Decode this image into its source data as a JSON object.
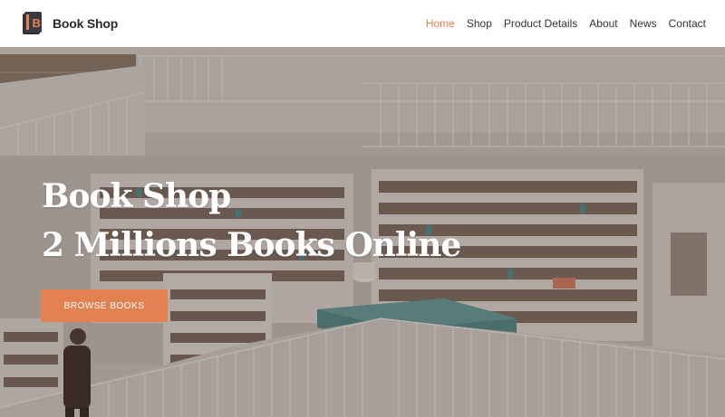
{
  "brand": {
    "name": "Book Shop",
    "logo_letter": "B",
    "accent_color": "#e38152",
    "logo_color": "#2f2f35"
  },
  "nav": {
    "items": [
      {
        "label": "Home",
        "active": true
      },
      {
        "label": "Shop",
        "active": false
      },
      {
        "label": "Product Details",
        "active": false
      },
      {
        "label": "About",
        "active": false
      },
      {
        "label": "News",
        "active": false
      },
      {
        "label": "Contact",
        "active": false
      }
    ]
  },
  "hero": {
    "title_line1": "Book Shop",
    "title_line2": "2 Millions Books Online",
    "cta_label": "BROWSE BOOKS",
    "background_scene": "library-interior"
  }
}
